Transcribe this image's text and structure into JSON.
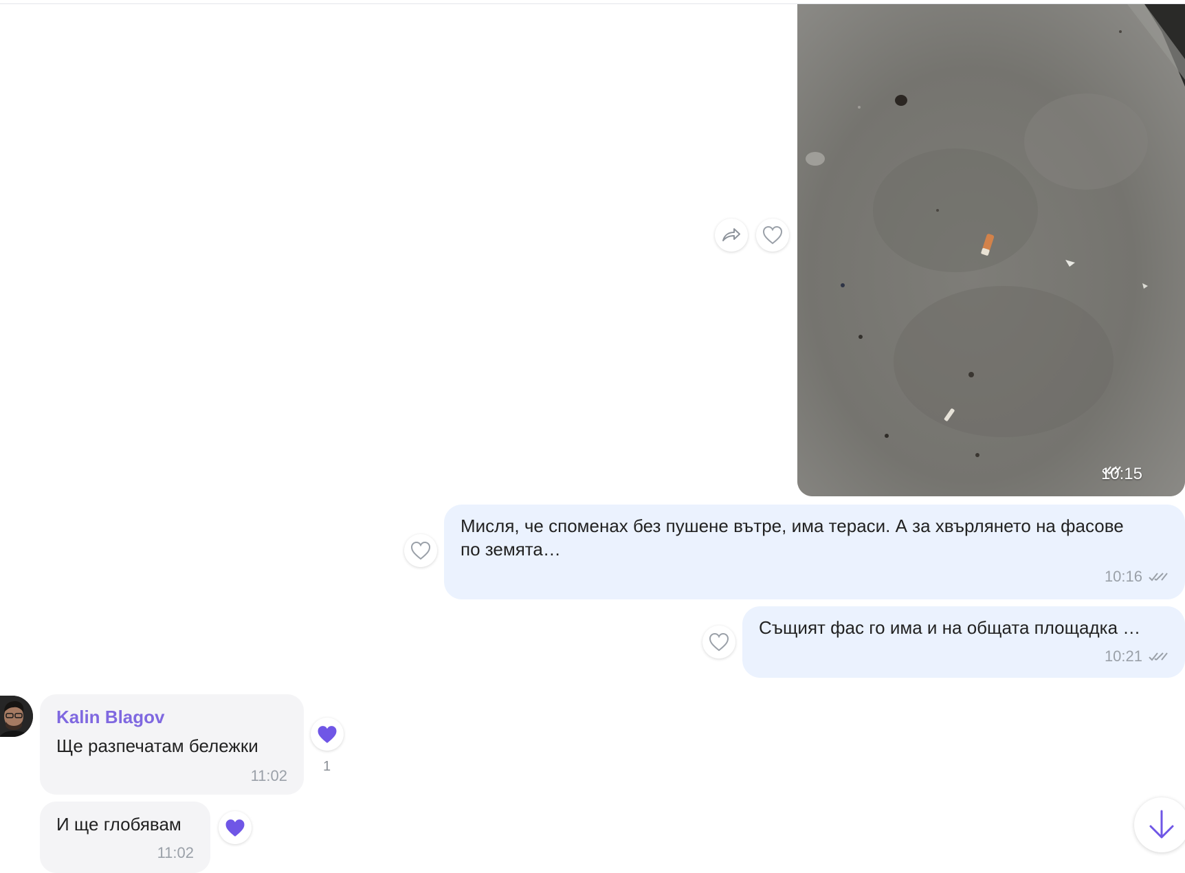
{
  "messages": [
    {
      "id": "photo",
      "direction": "outgoing",
      "type": "photo",
      "image_description": "concrete floor with cigarette butt",
      "time": "10:15",
      "status": "double-check-icon"
    },
    {
      "id": "m1",
      "direction": "outgoing",
      "text": "Мисля, че споменах без пушене вътре, има тераси. А за хвърлянето на фасове по земята…",
      "time": "10:16",
      "status": "double-check-icon"
    },
    {
      "id": "m2",
      "direction": "outgoing",
      "text": "Същият фас го има и на общата площадка …",
      "time": "10:21",
      "status": "double-check-icon"
    },
    {
      "id": "m3",
      "direction": "incoming",
      "sender": "Kalin Blagov",
      "text": "Ще разпечатам бележки",
      "time": "11:02",
      "reaction": {
        "icon": "heart-filled-icon",
        "count": "1"
      }
    },
    {
      "id": "m4",
      "direction": "incoming",
      "text": "И ще глобявам",
      "time": "11:02",
      "reaction": {
        "icon": "heart-filled-icon"
      }
    }
  ],
  "colors": {
    "accent": "#7f68e0",
    "outgoing_bubble": "#ebf2fe",
    "incoming_bubble": "#f4f4f6",
    "muted_text": "#9aa0a8"
  },
  "icons": [
    "share-icon",
    "heart-outline-icon",
    "heart-filled-icon",
    "double-check-icon",
    "arrow-down-icon"
  ]
}
